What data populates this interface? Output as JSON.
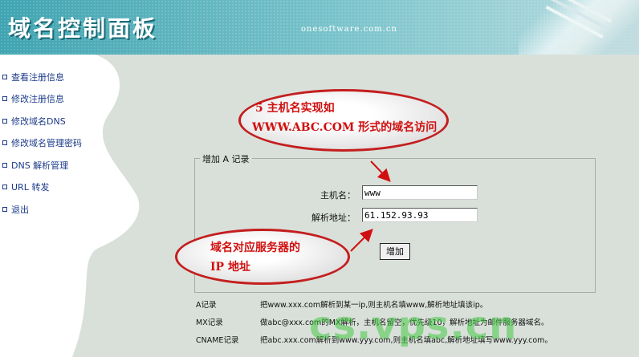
{
  "header": {
    "title": "域名控制面板",
    "site_url": "onesoftware.com.cn"
  },
  "sidebar": {
    "items": [
      {
        "label": "查看注册信息"
      },
      {
        "label": "修改注册信息"
      },
      {
        "label": "修改域名DNS"
      },
      {
        "label": "修改域名管理密码"
      },
      {
        "label": "DNS 解析管理"
      },
      {
        "label": "URL 转发"
      },
      {
        "label": "退出"
      }
    ]
  },
  "form": {
    "legend": "增加 A 记录",
    "hostname_label": "主机名：",
    "hostname_value": "www",
    "address_label": "解析地址：",
    "address_value": "61.152.93.93",
    "submit_label": "增加"
  },
  "callouts": {
    "top": {
      "line1": "5 主机名实现如",
      "line2": "WWW.ABC.COM 形式的域名访问"
    },
    "bottom": {
      "line1": "域名对应服务器的",
      "line2": "IP 地址"
    }
  },
  "notes": [
    {
      "label": "A记录",
      "desc": "把www.xxx.com解析到某一ip,则主机名填www,解析地址填该ip。"
    },
    {
      "label": "MX记录",
      "desc": "做abc@xxx.com的MX解析，主机名留空，优先级10，解析地址为邮件服务器域名。"
    },
    {
      "label": "CNAME记录",
      "desc": "把abc.xxx.com解析到www.yyy.com,则主机名填abc,解析地址填写www.yyy.com。"
    }
  ],
  "watermark": "cs.vps.cn",
  "colors": {
    "header_teal": "#3fa4b1",
    "menu_text": "#1c3b8a",
    "callout_red": "#c41e1e",
    "watermark_green": "#46c846"
  }
}
